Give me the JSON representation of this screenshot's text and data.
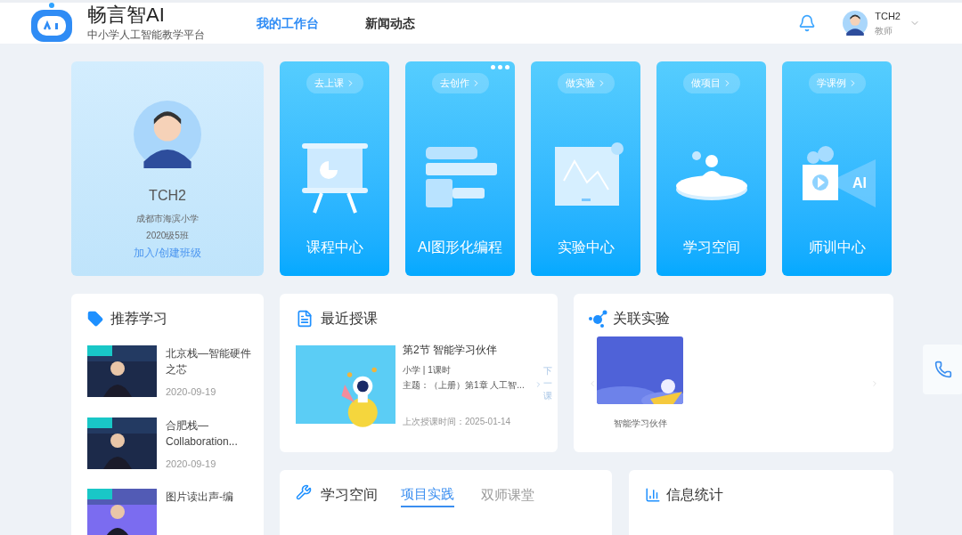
{
  "header": {
    "brand": "畅言智AI",
    "subtitle": "中小学人工智能教学平台",
    "nav": [
      {
        "label": "我的工作台",
        "selected": true
      },
      {
        "label": "新闻动态",
        "selected": false
      }
    ],
    "user": {
      "name": "TCH2",
      "role": "教师"
    }
  },
  "profile": {
    "name": "TCH2",
    "school": "成都市海滨小学",
    "class": "2020级5班",
    "link": "加入/创建班级"
  },
  "tiles": [
    {
      "kind": "board",
      "action": "去上课",
      "title": "课程中心",
      "more": false
    },
    {
      "kind": "blocks",
      "action": "去创作",
      "title": "AI图形化编程",
      "more": true
    },
    {
      "kind": "monitor",
      "action": "做实验",
      "title": "实验中心",
      "more": false
    },
    {
      "kind": "table",
      "action": "做项目",
      "title": "学习空间",
      "more": false
    },
    {
      "kind": "camera",
      "action": "学课例",
      "title": "师训中心",
      "more": false,
      "icon_label": "AI"
    }
  ],
  "recommend": {
    "title": "推荐学习",
    "items": [
      {
        "title": "北京栈—智能硬件之芯",
        "date": "2020-09-19"
      },
      {
        "title": "合肥栈—Collaboration...",
        "date": "2020-09-19"
      },
      {
        "title": "图片读出声-编"
      }
    ]
  },
  "recent": {
    "title": "最近授课",
    "lesson": "第2节 智能学习伙伴",
    "meta": "小学 | 1课时",
    "topic": "主题：（上册）第1章 人工智...",
    "last_time": "上次授课时间：2025-01-14",
    "next": "下一课"
  },
  "related": {
    "title": "关联实验",
    "items": [
      {
        "caption": "智能学习伙伴"
      }
    ]
  },
  "space": {
    "title": "学习空间",
    "tabs": [
      {
        "label": "项目实践",
        "selected": true
      },
      {
        "label": "双师课堂",
        "selected": false
      }
    ]
  },
  "stats": {
    "title": "信息统计"
  }
}
